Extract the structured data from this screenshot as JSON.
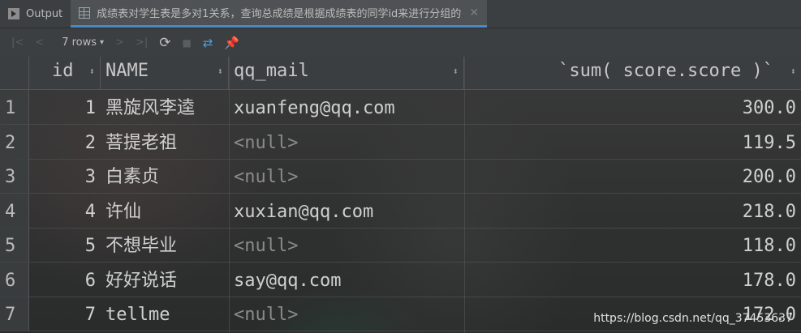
{
  "tabs": [
    {
      "label": "Output",
      "icon": "output-icon"
    },
    {
      "label": "成绩表对学生表是多对1关系，查询总成绩是根据成绩表的同学id来进行分组的",
      "icon": "table-icon"
    }
  ],
  "toolbar": {
    "rows_label": "7 rows",
    "icons": [
      "first-page-icon",
      "prev-page-icon",
      "next-page-icon",
      "last-page-icon",
      "refresh-icon",
      "stop-icon",
      "compare-icon",
      "pin-icon"
    ]
  },
  "columns": [
    "id",
    "NAME",
    "qq_mail",
    "`sum( score.score )`"
  ],
  "rows": [
    {
      "num": "1",
      "id": "1",
      "name": "黑旋风李逵",
      "qq_mail": "xuanfeng@qq.com",
      "sum": "300.0",
      "null": false
    },
    {
      "num": "2",
      "id": "2",
      "name": "菩提老祖",
      "qq_mail": "<null>",
      "sum": "119.5",
      "null": true
    },
    {
      "num": "3",
      "id": "3",
      "name": "白素贞",
      "qq_mail": "<null>",
      "sum": "200.0",
      "null": true
    },
    {
      "num": "4",
      "id": "4",
      "name": "许仙",
      "qq_mail": "xuxian@qq.com",
      "sum": "218.0",
      "null": false
    },
    {
      "num": "5",
      "id": "5",
      "name": "不想毕业",
      "qq_mail": "<null>",
      "sum": "118.0",
      "null": true
    },
    {
      "num": "6",
      "id": "6",
      "name": "好好说话",
      "qq_mail": "say@qq.com",
      "sum": "178.0",
      "null": false
    },
    {
      "num": "7",
      "id": "7",
      "name": "tellme",
      "qq_mail": "<null>",
      "sum": "172.0",
      "null": true
    }
  ],
  "watermark": "https://blog.csdn.net/qq_37453637"
}
